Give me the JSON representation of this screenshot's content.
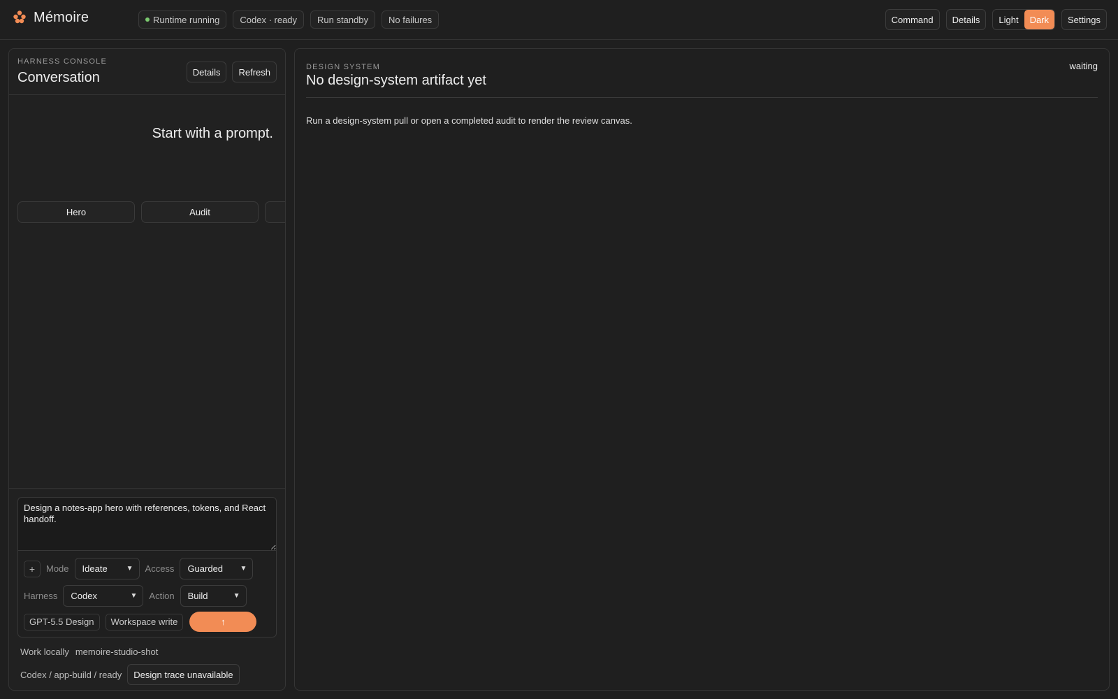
{
  "app": {
    "name": "Mémoire",
    "logo_icon": "flower-logo-icon",
    "accent": "#f28c55"
  },
  "status_pills": [
    "Runtime running",
    "Codex · ready",
    "Run standby",
    "No failures"
  ],
  "top_actions": {
    "command": "Command",
    "details": "Details",
    "settings": "Settings"
  },
  "theme": {
    "light": "Light",
    "dark": "Dark",
    "selected": "Dark"
  },
  "left_panel": {
    "eyebrow": "HARNESS CONSOLE",
    "title": "Conversation",
    "details": "Details",
    "refresh": "Refresh",
    "empty_prompt": "Start with a prompt.",
    "chips": [
      "Hero",
      "Audit",
      ""
    ]
  },
  "composer": {
    "text": "Design a notes-app hero with references, tokens, and React handoff.",
    "add": "+",
    "mode_label": "Mode",
    "mode_value": "Ideate",
    "access_label": "Access",
    "access_value": "Guarded",
    "harness_label": "Harness",
    "harness_value": "Codex",
    "action_label": "Action",
    "action_value": "Build",
    "model_tag": "GPT-5.5 Design",
    "permission_tag": "Workspace write",
    "send_icon": "↑"
  },
  "footer": {
    "work_label": "Work locally",
    "workspace": "memoire-studio-shot",
    "path": "Codex / app-build / ready",
    "trace": "Design trace unavailable"
  },
  "right_panel": {
    "eyebrow": "DESIGN SYSTEM",
    "title": "No design-system artifact yet",
    "state": "waiting",
    "description": "Run a design-system pull or open a completed audit to render the review canvas."
  }
}
